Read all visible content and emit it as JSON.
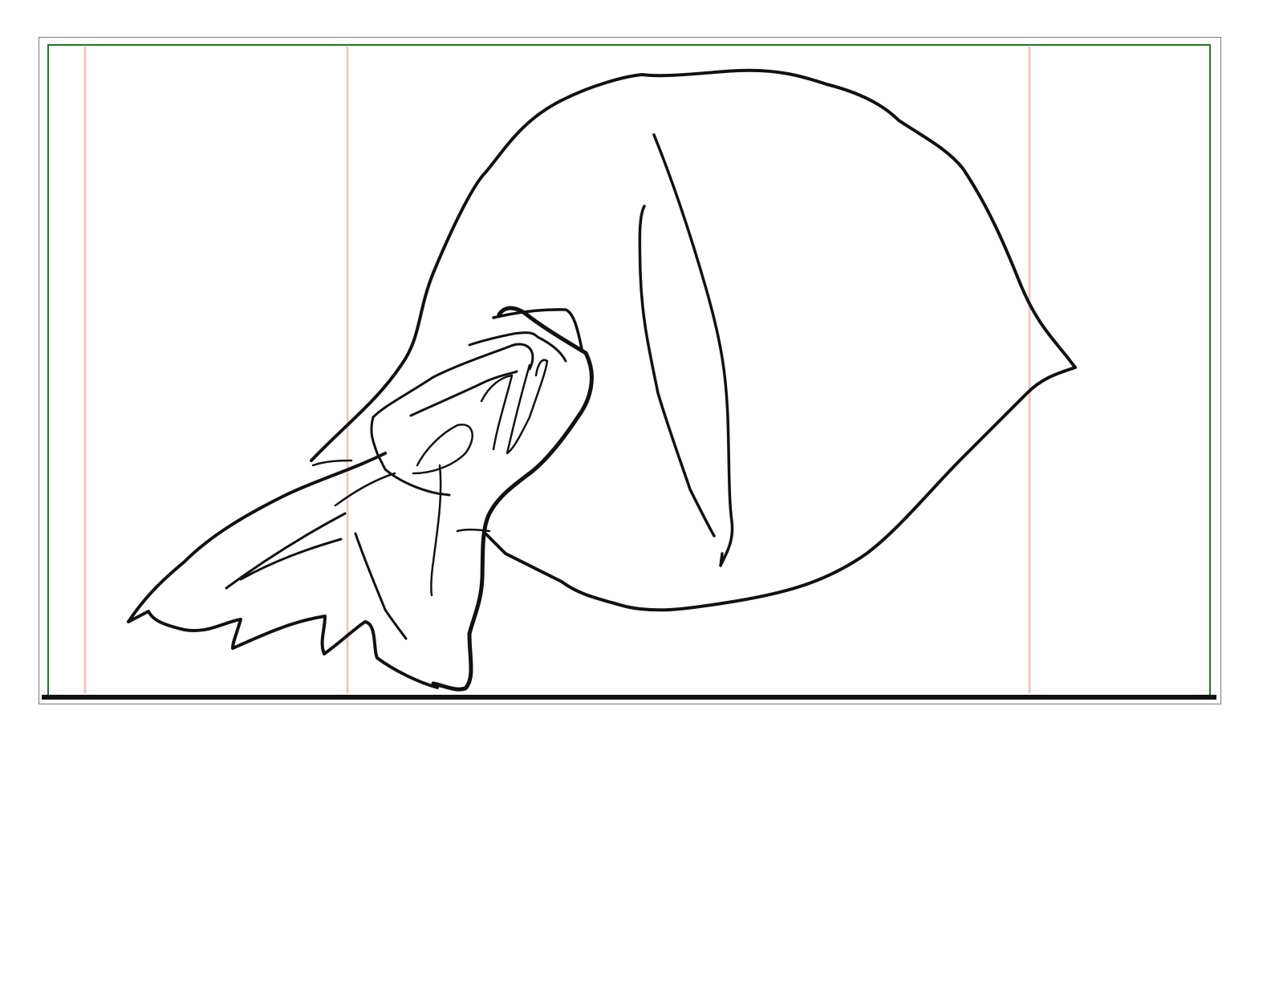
{
  "canvas": {
    "frame_border_color": "#7a7a7a",
    "safe_area_color": "#1e7a1e",
    "guide_color": "#f4c8b8",
    "ink_color": "#111111",
    "ground_line_color": "#111111",
    "background_color": "#ffffff"
  },
  "drawing": {
    "subject_icon": "sketch-cloth-bundle-icon"
  }
}
